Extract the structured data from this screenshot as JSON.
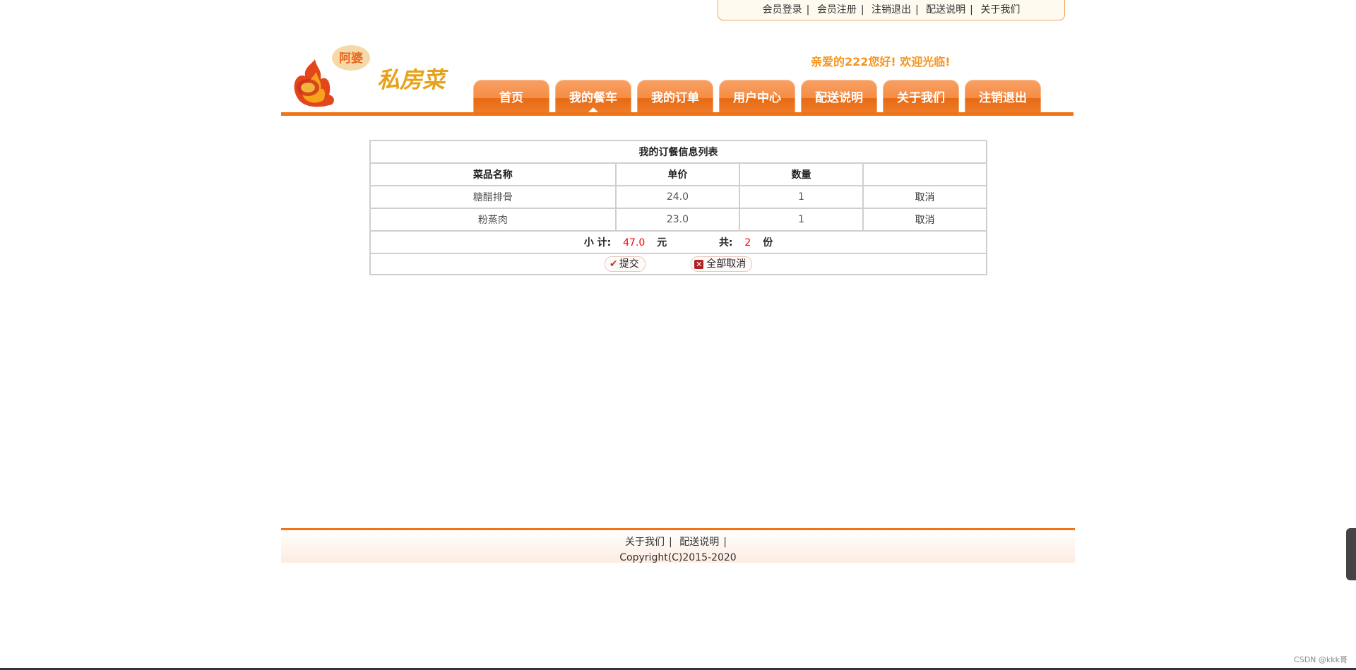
{
  "top_links": [
    "会员登录",
    "会员注册",
    "注销退出",
    "配送说明",
    "关于我们"
  ],
  "top_links_separator": "|",
  "logo": {
    "badge": "阿婆",
    "text": "私房菜"
  },
  "welcome": "亲爱的222您好!  欢迎光临!",
  "nav": [
    {
      "label": "首页",
      "active": false
    },
    {
      "label": "我的餐车",
      "active": true
    },
    {
      "label": "我的订单",
      "active": false
    },
    {
      "label": "用户中心",
      "active": false
    },
    {
      "label": "配送说明",
      "active": false
    },
    {
      "label": "关于我们",
      "active": false
    },
    {
      "label": "注销退出",
      "active": false
    }
  ],
  "table": {
    "title": "我的订餐信息列表",
    "headers": [
      "菜品名称",
      "单价",
      "数量",
      ""
    ],
    "rows": [
      {
        "name": "糖醋排骨",
        "price": "24.0",
        "qty": "1",
        "action": "取消"
      },
      {
        "name": "粉蒸肉",
        "price": "23.0",
        "qty": "1",
        "action": "取消"
      }
    ],
    "subtotal_label": "小 计:",
    "subtotal_value": "47.0",
    "currency": "元",
    "count_label": "共:",
    "count_value": "2",
    "count_unit": "份",
    "submit_label": "提交",
    "cancel_all_label": "全部取消"
  },
  "footer": {
    "links": [
      "关于我们",
      "配送说明"
    ],
    "separator": "|",
    "copyright": "Copyright(C)2015-2020"
  },
  "watermark": "CSDN @kkk哥",
  "colors": {
    "accent": "#ef7417",
    "welcome": "#f7941d",
    "highlight": "#ff0000"
  }
}
